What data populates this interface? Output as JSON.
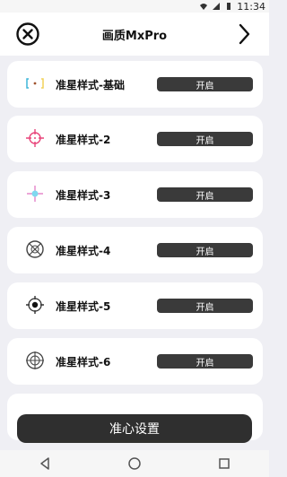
{
  "status_bar": {
    "time": "11:34"
  },
  "app_bar": {
    "title": "画质MxPro",
    "close_icon": "close-circle-icon",
    "next_icon": "chevron-right-icon"
  },
  "crosshair_list": [
    {
      "label": "准星样式-基础",
      "toggle": "开启",
      "icon": "crosshair-basic-icon"
    },
    {
      "label": "准星样式-2",
      "toggle": "开启",
      "icon": "crosshair-circle-icon"
    },
    {
      "label": "准星样式-3",
      "toggle": "开启",
      "icon": "crosshair-cyan-icon"
    },
    {
      "label": "准星样式-4",
      "toggle": "开启",
      "icon": "crosshair-scope-icon"
    },
    {
      "label": "准星样式-5",
      "toggle": "开启",
      "icon": "crosshair-dot-icon"
    },
    {
      "label": "准星样式-6",
      "toggle": "开启",
      "icon": "crosshair-compass-icon"
    }
  ],
  "bottom_button": {
    "label": "准心设置"
  },
  "nav_bar": {
    "back_icon": "back-triangle-icon",
    "home_icon": "home-circle-icon",
    "recents_icon": "recents-square-icon"
  },
  "colors": {
    "toggle_bg": "#3a3a3a",
    "button_bg": "#2f2f2f",
    "page_bg": "#efeff4"
  }
}
